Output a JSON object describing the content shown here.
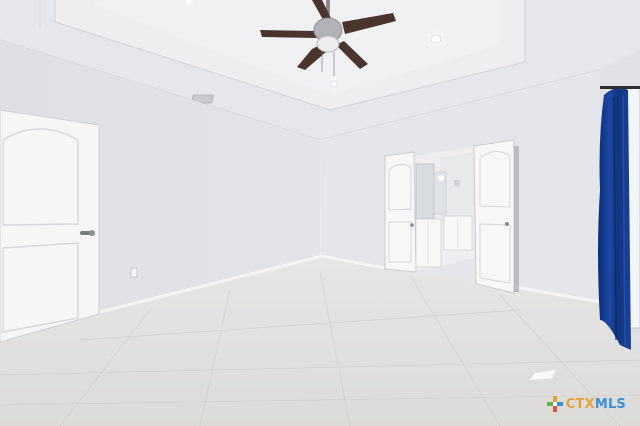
{
  "photo": {
    "subject": "vacant-bedroom-interior",
    "objects": [
      "ceiling-fan",
      "recessed-lights",
      "tray-ceiling",
      "entry-door",
      "double-doors",
      "ensuite-bathroom",
      "blue-curtain",
      "tile-floor",
      "air-vent",
      "wall-outlet"
    ]
  },
  "watermark": {
    "part_a": "CTX",
    "part_b": "MLS"
  },
  "colors": {
    "wall": "#e4e5e8",
    "ceiling": "#ececee",
    "floor": "#e2e1df",
    "door": "#f6f6f7",
    "curtain": "#173f96",
    "fan_blade": "#4a342c"
  }
}
